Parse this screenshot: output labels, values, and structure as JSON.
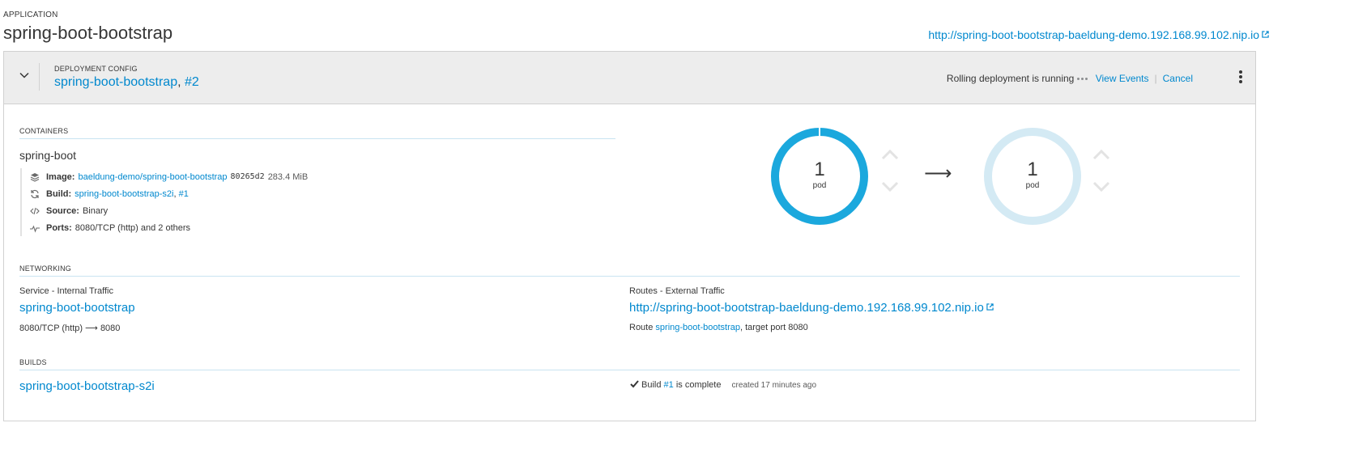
{
  "application": {
    "label": "APPLICATION",
    "name": "spring-boot-bootstrap",
    "url": "http://spring-boot-bootstrap-baeldung-demo.192.168.99.102.nip.io"
  },
  "deployment": {
    "label": "DEPLOYMENT CONFIG",
    "name": "spring-boot-bootstrap",
    "separator": ",",
    "revision": "#2",
    "status_text": "Rolling deployment is running",
    "view_events": "View Events",
    "divider": "|",
    "cancel": "Cancel"
  },
  "containers": {
    "label": "CONTAINERS",
    "name": "spring-boot",
    "image": {
      "key": "Image:",
      "repo": "baeldung-demo/spring-boot-bootstrap",
      "sha": "80265d2",
      "size": "283.4 MiB"
    },
    "build": {
      "key": "Build:",
      "name": "spring-boot-bootstrap-s2i",
      "separator": ",",
      "number": "#1"
    },
    "source": {
      "key": "Source:",
      "value": "Binary"
    },
    "ports": {
      "key": "Ports:",
      "value": "8080/TCP (http) and 2 others"
    }
  },
  "pods": {
    "old": {
      "count": "1",
      "label": "pod"
    },
    "arrow": "⟶",
    "new": {
      "count": "1",
      "label": "pod"
    }
  },
  "networking": {
    "label": "NETWORKING",
    "service_title": "Service - Internal Traffic",
    "service_name": "spring-boot-bootstrap",
    "service_port": "8080/TCP (http) ⟶ 8080",
    "routes_title": "Routes - External Traffic",
    "route_url": "http://spring-boot-bootstrap-baeldung-demo.192.168.99.102.nip.io",
    "route_prefix": "Route",
    "route_name": "spring-boot-bootstrap",
    "route_suffix": ", target port 8080"
  },
  "builds": {
    "label": "BUILDS",
    "name": "spring-boot-bootstrap-s2i",
    "status_prefix": "Build",
    "status_number": "#1",
    "status_suffix": "is complete",
    "created": "created 17 minutes ago"
  },
  "colors": {
    "link": "#0088ce",
    "donut_active": "#1ba8dd",
    "donut_pending": "#d4eaf4",
    "header_bg": "#ededed"
  },
  "icons": {
    "toggle": "chevron-down-icon",
    "external": "external-link-icon",
    "image": "layers-icon",
    "build": "refresh-icon",
    "source": "code-icon",
    "ports": "pulse-icon",
    "kebab": "kebab-icon",
    "check": "check-icon"
  }
}
